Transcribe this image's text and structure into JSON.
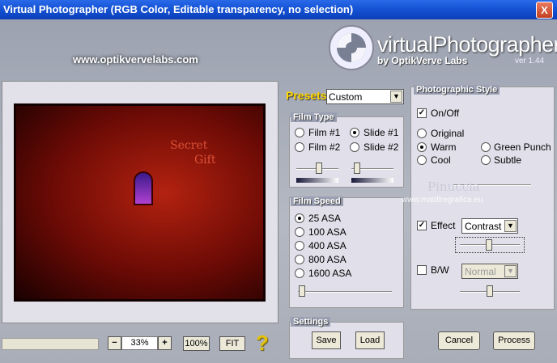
{
  "window": {
    "title": "Virtual Photographer (RGB Color, Editable transparency, no selection)",
    "close_label": "X"
  },
  "header": {
    "website": "www.optikvervelabs.com",
    "brand_name": "virtualPhotographer",
    "brand_by": "by OptikVerve Labs",
    "version": "ver 1.44"
  },
  "preview": {
    "watermark_title_1": "Secret",
    "watermark_title_2": "Gift"
  },
  "zoom": {
    "minus": "−",
    "value": "33%",
    "plus": "+",
    "hundred": "100%",
    "fit": "FIT",
    "help": "?"
  },
  "presets": {
    "label": "Presets",
    "value": "Custom"
  },
  "film_type": {
    "title": "Film Type",
    "options": [
      "Film #1",
      "Slide #1",
      "Film #2",
      "Slide #2"
    ],
    "selected": "Slide #1"
  },
  "film_speed": {
    "title": "Film Speed",
    "options": [
      "25 ASA",
      "100 ASA",
      "400 ASA",
      "800 ASA",
      "1600 ASA"
    ],
    "selected": "25 ASA"
  },
  "settings": {
    "title": "Settings",
    "save": "Save",
    "load": "Load"
  },
  "style": {
    "title": "Photographic Style",
    "on_off_label": "On/Off",
    "on_off_checked": true,
    "options": [
      "Original",
      "Warm",
      "Green Punch",
      "Cool",
      "Subtle"
    ],
    "selected": "Warm",
    "effect_label": "Effect",
    "effect_checked": true,
    "effect_value": "Contrast",
    "bw_label": "B/W",
    "bw_checked": false,
    "bw_value": "Normal"
  },
  "watermark": {
    "signature": "Pinuccia",
    "url": "www.maidiregrafica.eu"
  },
  "actions": {
    "cancel": "Cancel",
    "process": "Process"
  }
}
